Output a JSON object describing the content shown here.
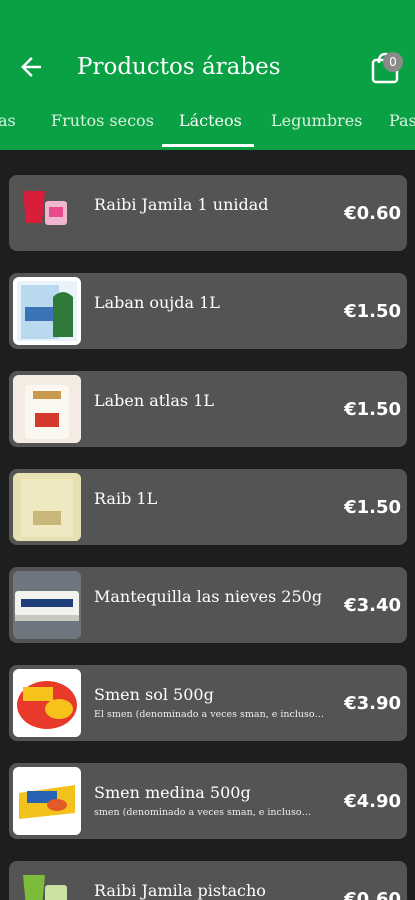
{
  "appbar": {
    "title": "Productos árabes",
    "cart_count": "0"
  },
  "tabs": [
    {
      "label": "as"
    },
    {
      "label": "Frutos secos"
    },
    {
      "label": "Lácteos",
      "active": true
    },
    {
      "label": "Legumbres"
    },
    {
      "label": "Pas"
    }
  ],
  "products": [
    {
      "name": "Raibi Jamila 1 unidad",
      "desc": "",
      "price": "€0.60",
      "icon": "raibi-jamila-icon"
    },
    {
      "name": "Laban oujda 1L",
      "desc": "",
      "price": "€1.50",
      "icon": "laban-oujda-icon"
    },
    {
      "name": "Laben atlas 1L",
      "desc": "",
      "price": "€1.50",
      "icon": "laben-atlas-icon"
    },
    {
      "name": "Raib 1L",
      "desc": "",
      "price": "€1.50",
      "icon": "raib-icon"
    },
    {
      "name": "Mantequilla las nieves 250g",
      "desc": "",
      "price": "€3.40",
      "icon": "mantequilla-icon"
    },
    {
      "name": "Smen sol 500g",
      "desc": "El smen (denominado a veces sman, e incluso…",
      "price": "€3.90",
      "icon": "smen-sol-icon"
    },
    {
      "name": "Smen medina 500g",
      "desc": "smen (denominado a veces sman, e incluso…",
      "price": "€4.90",
      "icon": "smen-medina-icon"
    },
    {
      "name": "Raibi Jamila pistacho",
      "desc": "",
      "price": "€0.60",
      "icon": "raibi-pistacho-icon"
    }
  ],
  "colors": {
    "brand_green": "#0aa144",
    "card_bg": "#545454",
    "page_bg": "#1e1e1e"
  }
}
